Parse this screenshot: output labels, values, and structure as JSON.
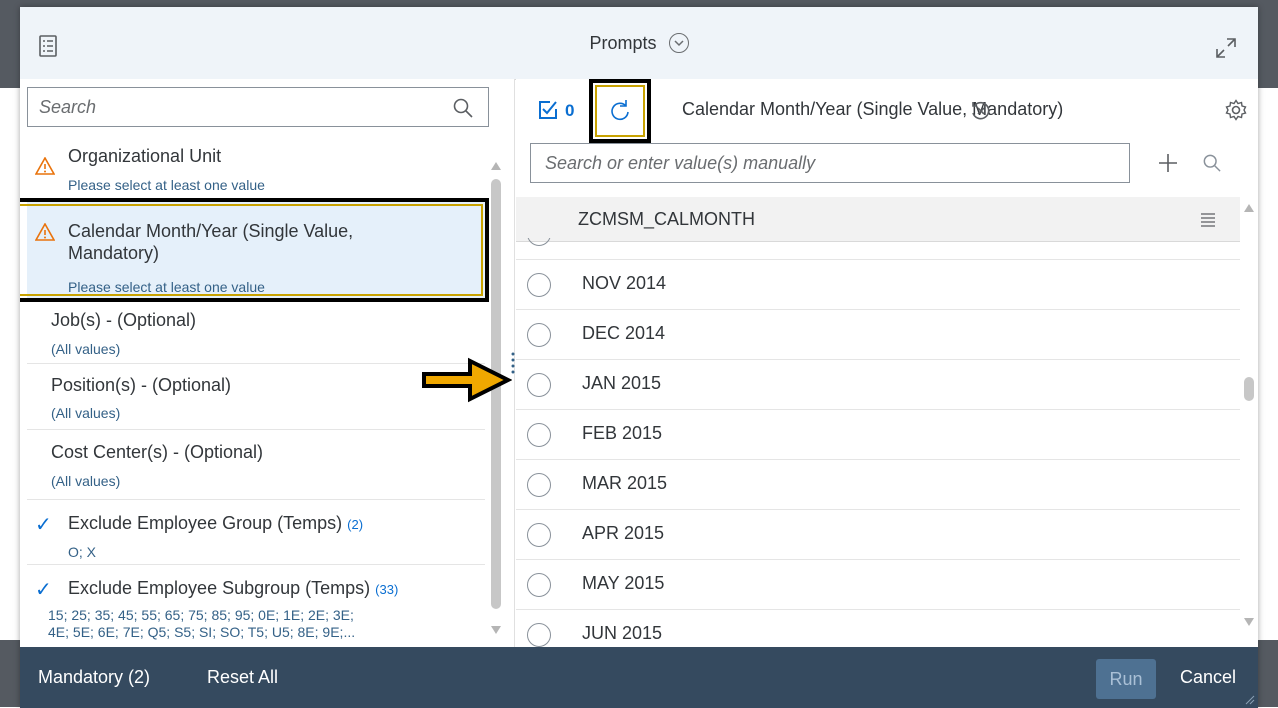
{
  "header": {
    "title": "Prompts"
  },
  "left": {
    "search_placeholder": "Search",
    "items": [
      {
        "title": "Organizational Unit",
        "sub": "Please select at least one value",
        "status": "warning"
      },
      {
        "title_line1": "Calendar Month/Year (Single Value,",
        "title_line2": "Mandatory)",
        "sub": "Please select at least one value",
        "status": "warning",
        "selected": true
      },
      {
        "title": "Job(s) - (Optional)",
        "sub": "(All values)"
      },
      {
        "title": "Position(s) - (Optional)",
        "sub": "(All values)"
      },
      {
        "title": "Cost Center(s) - (Optional)",
        "sub": "(All values)"
      },
      {
        "title": "Exclude Employee Group (Temps)",
        "count": "(2)",
        "sub": "O; X",
        "status": "checked"
      },
      {
        "title": "Exclude Employee Subgroup (Temps)",
        "count": "(33)",
        "sub_line1": "15; 25; 35; 45; 55; 65; 75; 85; 95; 0E; 1E; 2E; 3E;",
        "sub_line2": "4E; 5E; 6E; 7E; Q5; S5; SI; SO; T5; U5; 8E; 9E;...",
        "status": "checked"
      }
    ]
  },
  "right": {
    "selected_count": "0",
    "prompt_title": "Calendar Month/Year (Single Value, Mandatory)",
    "search_placeholder": "Search or enter value(s) manually",
    "column_header": "ZCMSM_CALMONTH",
    "rows": [
      "NOV 2014",
      "DEC 2014",
      "JAN 2015",
      "FEB 2015",
      "MAR 2015",
      "APR 2015",
      "MAY 2015",
      "JUN 2015"
    ]
  },
  "footer": {
    "mandatory": "Mandatory (2)",
    "reset": "Reset All",
    "run": "Run",
    "cancel": "Cancel"
  },
  "colors": {
    "footer_bg": "#354a5f",
    "header_bg": "#eff4f9",
    "warning": "#e9730c",
    "link": "#346187",
    "accent": "#0a6ed1",
    "highlight_box": "#c8a200",
    "arrow": "#f0a800"
  }
}
